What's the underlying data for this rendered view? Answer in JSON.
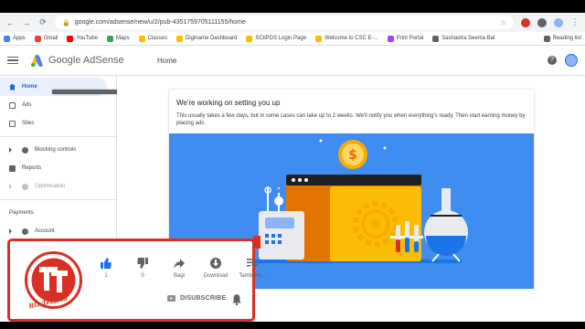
{
  "browser": {
    "url": "google.com/adsense/new/u/2/pub-4351759705111155/home",
    "bookmarks": [
      "Apps",
      "Gmail",
      "YouTube",
      "Maps",
      "Classes",
      "Diginame Dashboard",
      "SCtiPDS Login Page",
      "Welcome to CSC E-...",
      "Print Portal",
      "Sashastra Seema Bal"
    ],
    "reading_list": "Reading list"
  },
  "adsense": {
    "logo": "Google AdSense",
    "page_title": "Home",
    "sidebar": [
      {
        "label": "Home",
        "icon": "home-icon",
        "active": true
      },
      {
        "label": "Ads",
        "icon": "ads-icon"
      },
      {
        "label": "Sites",
        "icon": "sites-icon"
      },
      {
        "label": "Blocking controls",
        "icon": "expand-arrow-icon"
      },
      {
        "label": "Reports",
        "icon": "reports-icon"
      },
      {
        "label": "Optimisation",
        "icon": "expand-arrow-icon",
        "disabled": true
      },
      {
        "label": "Payments",
        "icon": "payments-icon"
      },
      {
        "label": "Account",
        "icon": "expand-arrow-icon"
      }
    ],
    "card": {
      "title": "We're working on setting you up",
      "text": "This usually takes a few days, but in some cases can take up to 2 weeks. We'll notify you when everything's ready. Then start earning money by placing ads."
    }
  },
  "overlay": {
    "channel_logo_text": "Riz Techno",
    "actions": [
      {
        "label": "1",
        "icon": "thumbs-up-icon"
      },
      {
        "label": "0",
        "icon": "thumbs-down-icon"
      },
      {
        "label": "Bagi",
        "icon": "share-icon"
      },
      {
        "label": "Download",
        "icon": "download-icon"
      },
      {
        "label": "Tambahk...",
        "icon": "add-to-playlist-icon"
      }
    ],
    "subscribe_label": "DISUBSCRIBE"
  },
  "colors": {
    "accent": "#1967d2",
    "illustration_bg": "#3f8df0",
    "overlay_border": "#d93025"
  }
}
